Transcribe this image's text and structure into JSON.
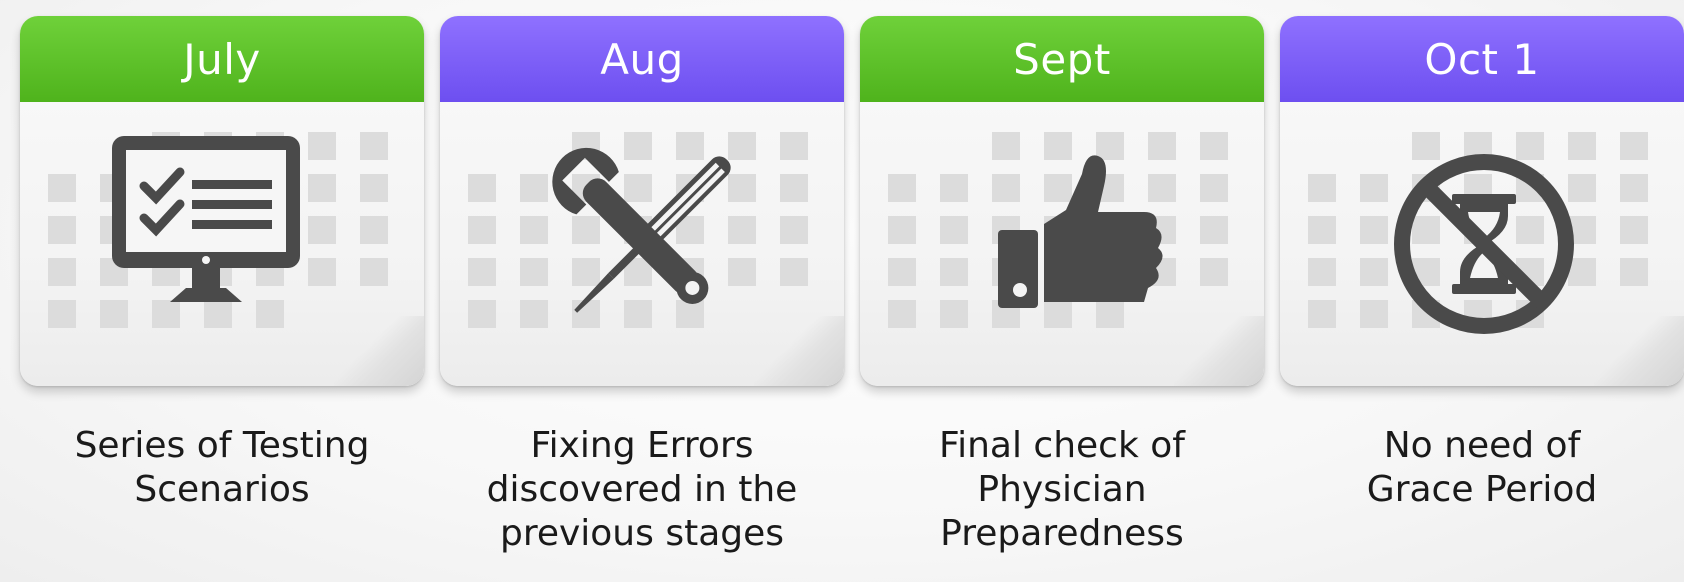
{
  "milestones": [
    {
      "label": "July",
      "color": "#5cbf27",
      "icon": "monitor-checklist-icon",
      "description": "Series of Testing Scenarios",
      "lines": [
        "Series of Testing",
        "Scenarios"
      ]
    },
    {
      "label": "Aug",
      "color": "#7b5cf7",
      "icon": "wrench-screwdriver-icon",
      "description": "Fixing Errors discovered in the previous stages",
      "lines": [
        "Fixing Errors",
        "discovered in the",
        "previous stages"
      ]
    },
    {
      "label": "Sept",
      "color": "#5cbf27",
      "icon": "thumbs-up-icon",
      "description": "Final check of Physician Preparedness",
      "lines": [
        "Final check of",
        "Physician",
        "Preparedness"
      ]
    },
    {
      "label": "Oct 1",
      "color": "#7b5cf7",
      "icon": "no-hourglass-icon",
      "description": "No need of Grace Period",
      "lines": [
        "No need of",
        "Grace Period"
      ]
    }
  ],
  "colors": {
    "green": "#5cbf27",
    "purple": "#7b5cf7",
    "icon": "#4a4a4a",
    "grid": "#dcdcdc"
  }
}
